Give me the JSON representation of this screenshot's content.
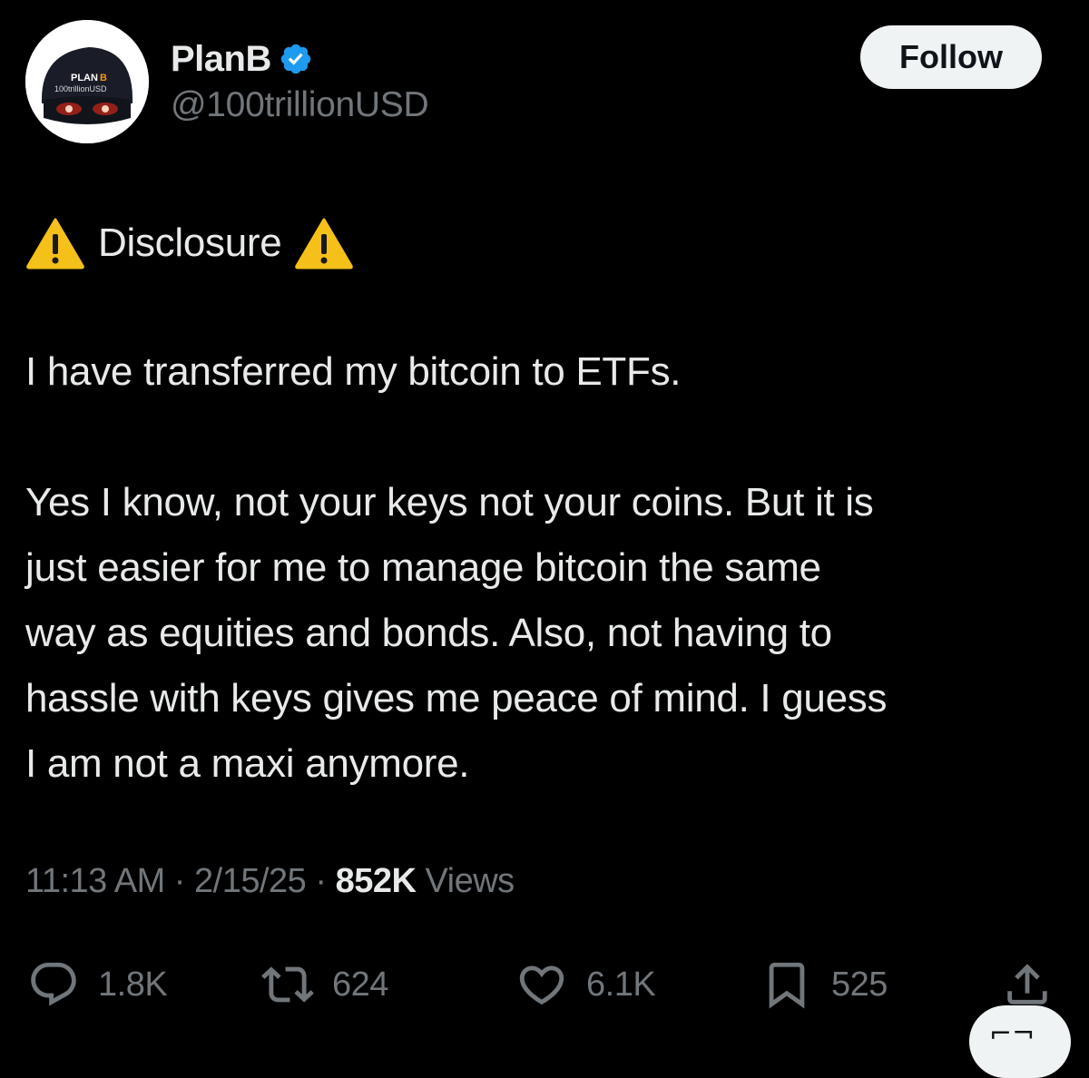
{
  "user": {
    "display_name": "PlanB",
    "handle": "@100trillionUSD",
    "avatar_text_top": "PLAN",
    "avatar_text_b": "B",
    "avatar_text_bottom": "100trillionUSD",
    "verified_icon": "verified-badge-icon",
    "verified_color": "#1d9bf0"
  },
  "follow_button": {
    "label": "Follow"
  },
  "post": {
    "disclosure_label": "Disclosure",
    "warning_icon": "warning-icon",
    "lines": [
      "I have transferred my bitcoin to ETFs.",
      "Yes I know, not your keys not your coins. But it is",
      "just easier for me to manage bitcoin the same",
      "way as equities and bonds. Also, not having to",
      "hassle with keys gives me peace of mind. I guess",
      "I am not a maxi anymore."
    ]
  },
  "meta": {
    "time": "11:13 AM",
    "separator": "·",
    "date": "2/15/25",
    "views_count": "852K",
    "views_label": "Views"
  },
  "actions": {
    "reply": {
      "icon": "reply-icon",
      "count": "1.8K"
    },
    "retweet": {
      "icon": "retweet-icon",
      "count": "624"
    },
    "like": {
      "icon": "heart-icon",
      "count": "6.1K"
    },
    "bookmark": {
      "icon": "bookmark-icon",
      "count": "525"
    },
    "share": {
      "icon": "share-icon"
    }
  },
  "colors": {
    "background": "#000000",
    "text_primary": "#e7e9ea",
    "text_secondary": "#71767b",
    "warning_yellow": "#f4c019",
    "follow_bg": "#eff3f4"
  }
}
